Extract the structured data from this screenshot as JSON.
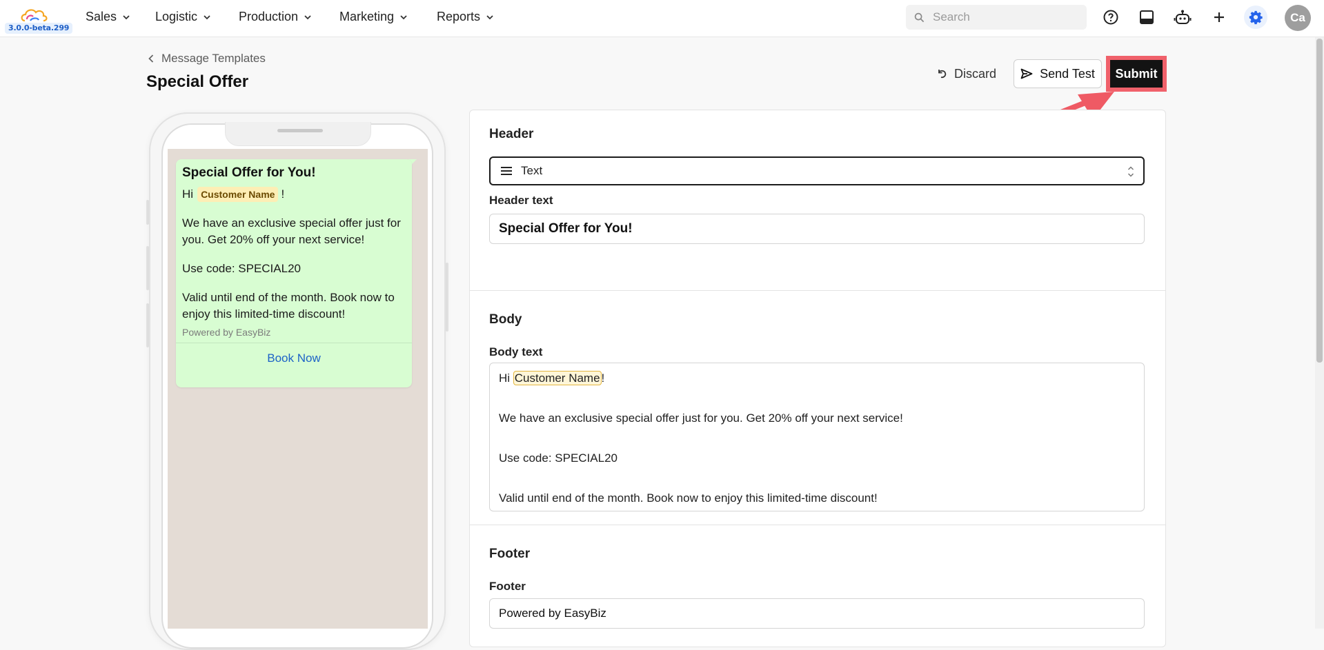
{
  "app": {
    "version": "3.0.0-beta.299",
    "nav": [
      {
        "label": "Sales"
      },
      {
        "label": "Logistic"
      },
      {
        "label": "Production"
      },
      {
        "label": "Marketing"
      },
      {
        "label": "Reports"
      }
    ],
    "search_placeholder": "Search",
    "avatar_initials": "Ca",
    "icons": [
      "help-icon",
      "inbox-icon",
      "bot-icon",
      "plus-icon",
      "gear-icon"
    ],
    "accent_color": "#2563eb"
  },
  "page": {
    "breadcrumb": "Message Templates",
    "title": "Special Offer",
    "actions": {
      "discard": "Discard",
      "send_test": "Send Test",
      "submit": "Submit"
    },
    "highlight_color": "#f0616b"
  },
  "preview": {
    "title": "Special Offer for You!",
    "greeting_prefix": "Hi",
    "greeting_chip": "Customer Name",
    "greeting_suffix": "!",
    "paragraph1": "We have an exclusive special offer just for you. Get 20% off your next service!",
    "paragraph2": "Use code: SPECIAL20",
    "paragraph3": "Valid until end of the month. Book now to enjoy this limited-time discount!",
    "footer": "Powered by EasyBiz",
    "cta": "Book Now"
  },
  "form": {
    "header": {
      "section_title": "Header",
      "type_value": "Text",
      "text_label": "Header text",
      "text_value": "Special Offer for You!"
    },
    "body": {
      "section_title": "Body",
      "text_label": "Body text",
      "line1_prefix": "Hi ",
      "line1_chip": "Customer Name",
      "line1_suffix": "!",
      "line2": "We have an exclusive special offer just for you. Get 20% off your next service!",
      "line3": "Use code: SPECIAL20",
      "line4": "Valid until end of the month. Book now to enjoy this limited-time discount!"
    },
    "footer": {
      "section_title": "Footer",
      "label": "Footer",
      "value": "Powered by EasyBiz"
    }
  }
}
